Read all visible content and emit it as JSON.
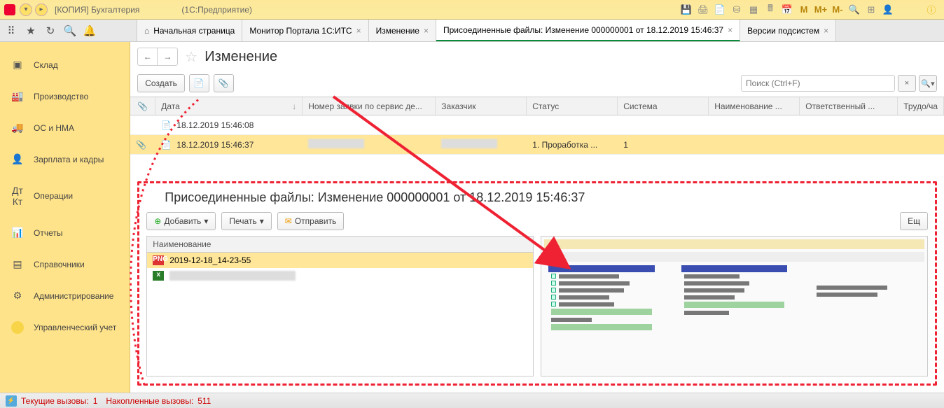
{
  "titlebar": {
    "title": "[КОПИЯ] Бухгалтерия",
    "suffix": "(1С:Предприятие)"
  },
  "tabs": {
    "home": "Начальная страница",
    "t1": "Монитор Портала 1С:ИТС",
    "t2": "Изменение",
    "t3": "Присоединенные файлы: Изменение 000000001 от 18.12.2019 15:46:37",
    "t4": "Версии подсистем"
  },
  "sidebar": {
    "items": [
      {
        "label": "Склад"
      },
      {
        "label": "Производство"
      },
      {
        "label": "ОС и НМА"
      },
      {
        "label": "Зарплата и кадры"
      },
      {
        "label": "Операции"
      },
      {
        "label": "Отчеты"
      },
      {
        "label": "Справочники"
      },
      {
        "label": "Администрирование"
      },
      {
        "label": "Управленческий учет"
      }
    ]
  },
  "page": {
    "title": "Изменение",
    "create": "Создать",
    "search_placeholder": "Поиск (Ctrl+F)"
  },
  "table": {
    "cols": {
      "date": "Дата",
      "req": "Номер заявки по сервис де...",
      "customer": "Заказчик",
      "status": "Статус",
      "system": "Система",
      "name": "Наименование ...",
      "resp": "Ответственный ...",
      "labor": "Трудо/ча"
    },
    "rows": [
      {
        "date": "18.12.2019 15:46:08",
        "status": "",
        "system": ""
      },
      {
        "date": "18.12.2019 15:46:37",
        "status": "1. Проработка ...",
        "system": "1"
      }
    ]
  },
  "attached": {
    "title": "Присоединенные файлы: Изменение 000000001 от 18.12.2019 15:46:37",
    "add": "Добавить",
    "print": "Печать",
    "send": "Отправить",
    "more": "Ещ",
    "colname": "Наименование",
    "files": [
      {
        "name": "2019-12-18_14-23-55",
        "type": "png"
      },
      {
        "name": "",
        "type": "xls"
      }
    ]
  },
  "status": {
    "cur_lbl": "Текущие вызовы:",
    "cur_val": "1",
    "acc_lbl": "Накопленные вызовы:",
    "acc_val": "511"
  }
}
